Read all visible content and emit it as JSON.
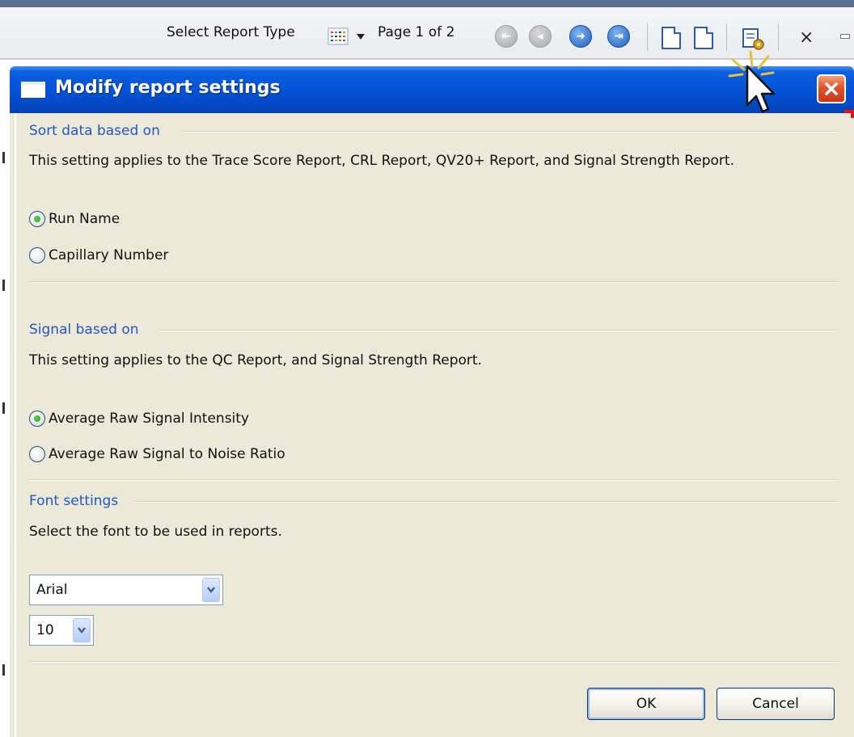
{
  "toolbar": {
    "select_report_type_label": "Select Report Type",
    "page_indicator": "Page 1 of 2",
    "close_glyph": "×"
  },
  "dialog": {
    "title": "Modify report settings",
    "sections": {
      "sort": {
        "title": "Sort data based on",
        "description": "This setting applies to the Trace Score Report, CRL Report, QV20+ Report, and Signal Strength Report.",
        "options": [
          "Run Name",
          "Capillary Number"
        ],
        "selected": "Run Name"
      },
      "signal": {
        "title": "Signal based on",
        "description": "This setting applies to the QC Report, and Signal Strength Report.",
        "options": [
          "Average Raw Signal Intensity",
          "Average Raw Signal to Noise Ratio"
        ],
        "selected": "Average Raw Signal Intensity"
      },
      "font": {
        "title": "Font settings",
        "description": "Select the font to be used in reports.",
        "font_name": "Arial",
        "font_size": "10"
      }
    },
    "buttons": {
      "ok": "OK",
      "cancel": "Cancel"
    }
  },
  "colors": {
    "titlebar": "#0653d8",
    "section_title": "#1f57c8",
    "dialog_bg": "#ece9d8",
    "close_button": "#e0522a"
  }
}
